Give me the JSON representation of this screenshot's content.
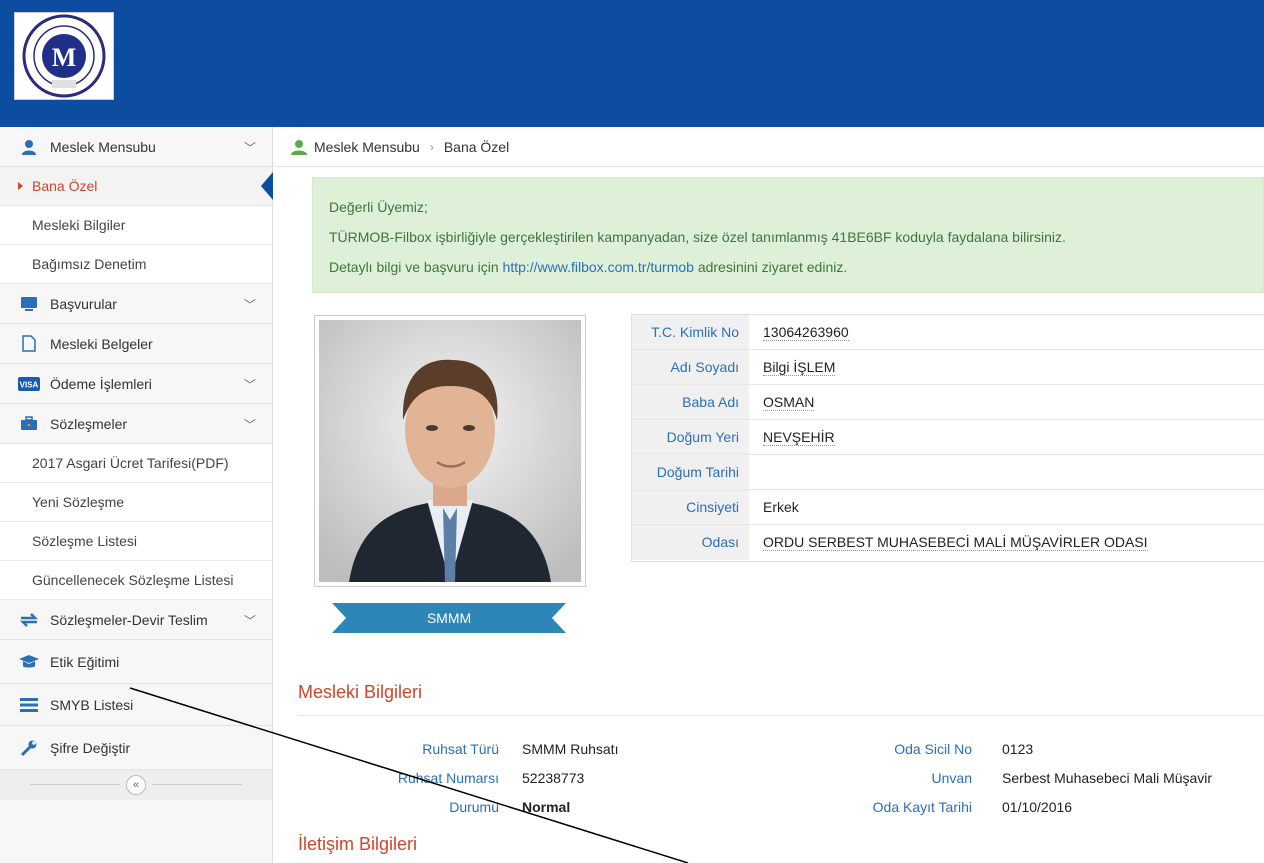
{
  "sidebar": {
    "items": [
      {
        "label": "Meslek Mensubu",
        "icon": "user-icon",
        "expandable": true
      },
      {
        "label": "Bana Özel",
        "sub": true,
        "active": true
      },
      {
        "label": "Mesleki Bilgiler",
        "sub": true
      },
      {
        "label": "Bağımsız Denetim",
        "sub": true
      },
      {
        "label": "Başvurular",
        "icon": "monitor-icon",
        "expandable": true
      },
      {
        "label": "Mesleki Belgeler",
        "icon": "document-icon"
      },
      {
        "label": "Ödeme İşlemleri",
        "icon": "visa-card-icon",
        "expandable": true
      },
      {
        "label": "Sözleşmeler",
        "icon": "briefcase-icon",
        "expandable": true
      },
      {
        "label": "2017 Asgari Ücret Tarifesi(PDF)",
        "sub": true
      },
      {
        "label": "Yeni Sözleşme",
        "sub": true
      },
      {
        "label": "Sözleşme Listesi",
        "sub": true
      },
      {
        "label": "Güncellenecek Sözleşme Listesi",
        "sub": true
      },
      {
        "label": "Sözleşmeler-Devir Teslim",
        "icon": "transfer-icon",
        "expandable": true
      },
      {
        "label": "Etik Eğitimi",
        "icon": "graduation-cap-icon"
      },
      {
        "label": "SMYB Listesi",
        "icon": "list-icon"
      },
      {
        "label": "Şifre Değiştir",
        "icon": "wrench-icon"
      }
    ],
    "collapse_label": "«"
  },
  "breadcrumb": {
    "root": "Meslek Mensubu",
    "current": "Bana Özel"
  },
  "notice": {
    "line1": "Değerli Üyemiz;",
    "line2": "TÜRMOB-Filbox işbirliğiyle gerçekleştirilen kampanyadan, size özel tanımlanmış 41BE6BF koduyla faydalana bilirsiniz.",
    "line3_pre": "Detaylı bilgi ve başvuru için ",
    "link": "http://www.filbox.com.tr/turmob",
    "line3_post": " adresinini ziyaret ediniz."
  },
  "profile": {
    "title_badge": "SMMM",
    "rows": [
      {
        "label": "T.C. Kimlik No",
        "value": "13064263960"
      },
      {
        "label": "Adı Soyadı",
        "value": "Bilgi İŞLEM"
      },
      {
        "label": "Baba Adı",
        "value": "OSMAN"
      },
      {
        "label": "Doğum Yeri",
        "value": "NEVŞEHİR"
      },
      {
        "label": "Doğum Tarihi",
        "value": ""
      },
      {
        "label": "Cinsiyeti",
        "value": "Erkek"
      },
      {
        "label": "Odası",
        "value": "ORDU SERBEST MUHASEBECİ MALİ MÜŞAVİRLER ODASI"
      }
    ]
  },
  "mesleki": {
    "title": "Mesleki Bilgileri",
    "left": [
      {
        "label": "Ruhsat Türü",
        "value": "SMMM Ruhsatı"
      },
      {
        "label": "Ruhsat Numarsı",
        "value": "52238773"
      },
      {
        "label": "Durumu",
        "value": "Normal"
      }
    ],
    "right": [
      {
        "label": "Oda Sicil No",
        "value": "0123"
      },
      {
        "label": "Unvan",
        "value": "Serbest Muhasebeci Mali Müşavir"
      },
      {
        "label": "Oda Kayıt Tarihi",
        "value": "01/10/2016"
      }
    ]
  },
  "iletisim": {
    "title": "İletişim Bilgileri"
  },
  "colors": {
    "header": "#0c4da2",
    "accent": "#d0452a",
    "link": "#2a6fb8",
    "ribbon": "#2e86b8"
  }
}
